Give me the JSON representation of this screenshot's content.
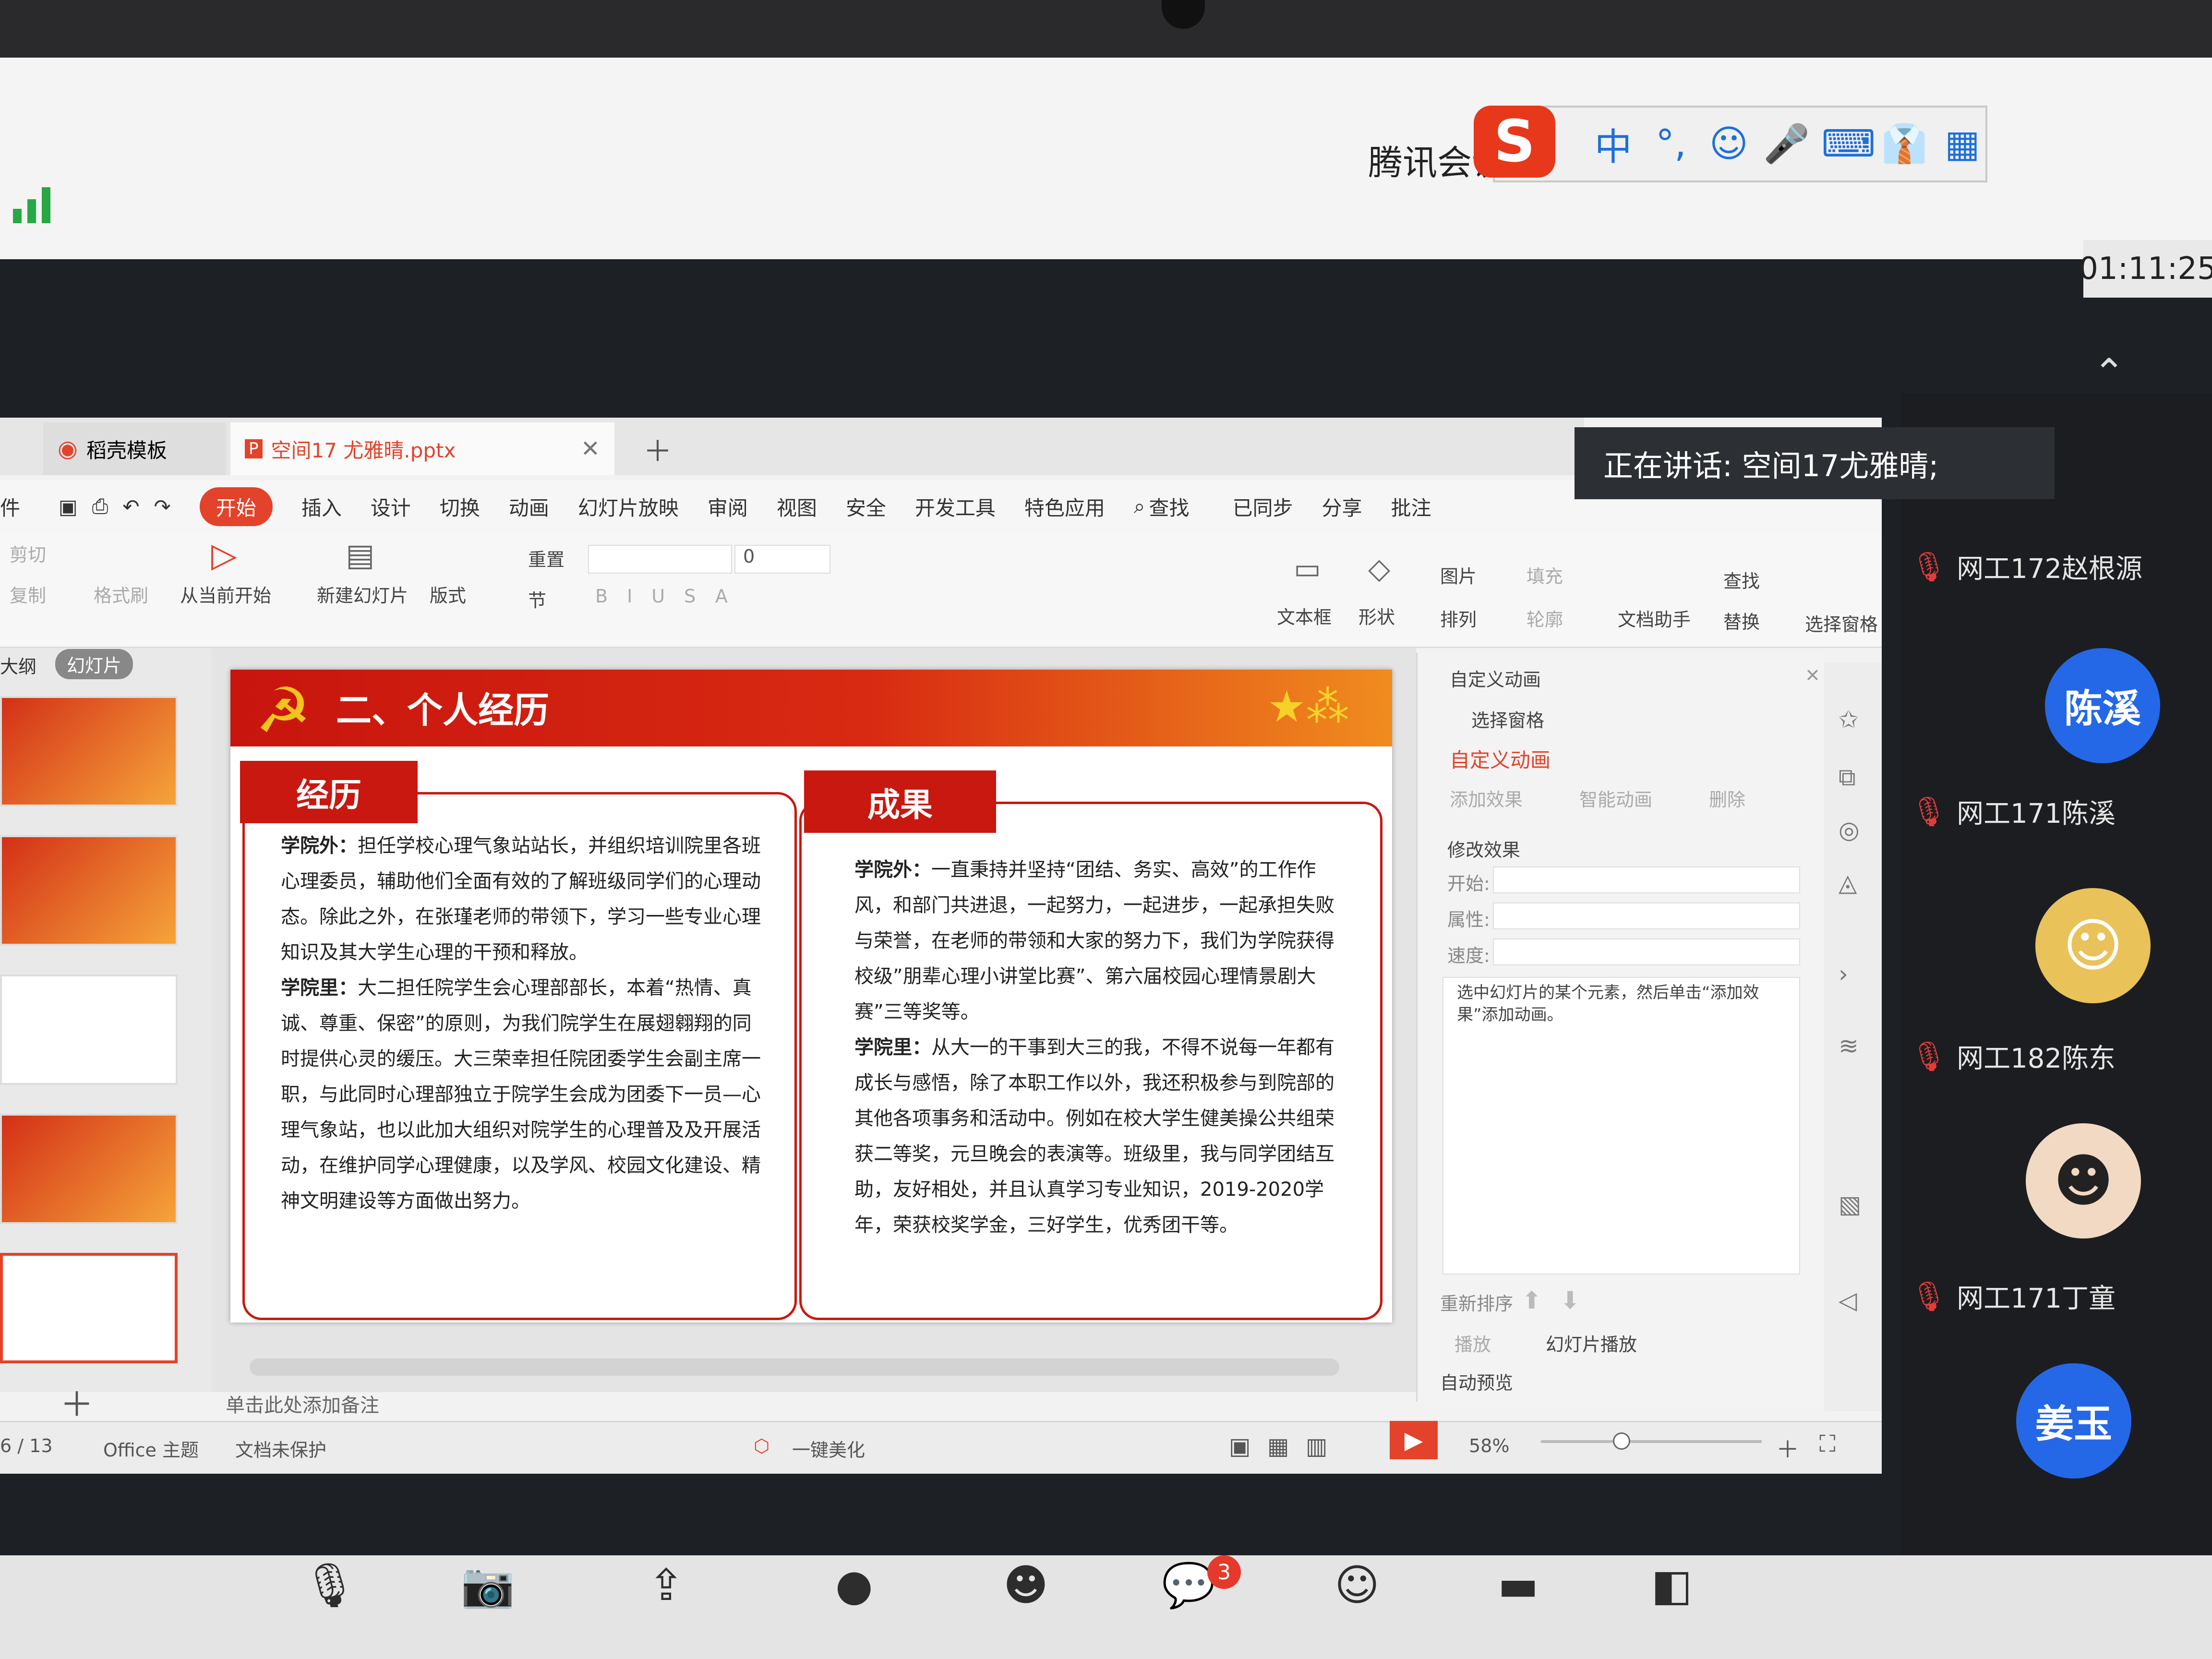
{
  "meeting": {
    "title": "腾讯会议",
    "timer": "01:11:25",
    "speaking": "正在讲话: 空间17尤雅晴;"
  },
  "ime": {
    "logo": "S",
    "items": [
      "中",
      "°,",
      "☺",
      "🎤",
      "⌨",
      "👔",
      "▦"
    ]
  },
  "participants": [
    {
      "name": "网工172赵根源",
      "muted": true
    },
    {
      "avatar_text": "陈溪",
      "avatar_color": "#2468e8"
    },
    {
      "name": "网工171陈溪",
      "muted": true
    },
    {
      "name": "网工182陈东",
      "muted": true
    },
    {
      "name": "网工171丁童",
      "muted": true
    },
    {
      "avatar_text": "姜玉",
      "avatar_color": "#2468e8"
    }
  ],
  "wps": {
    "tabs": [
      {
        "label": "稻壳模板"
      },
      {
        "label": "空间17 尤雅晴.pptx"
      }
    ],
    "menu": {
      "file": "件",
      "start": "开始",
      "items": [
        "插入",
        "设计",
        "切换",
        "动画",
        "幻灯片放映",
        "审阅",
        "视图",
        "安全",
        "开发工具",
        "特色应用"
      ],
      "search": "查找",
      "sync": "已同步",
      "share": "分享",
      "comment": "批注"
    },
    "ribbon": {
      "cut": "剪切",
      "copy": "复制",
      "format_painter": "格式刷",
      "from_current": "从当前开始",
      "new_slide": "新建幻灯片",
      "layout": "版式",
      "reset": "重置",
      "section": "节",
      "font_size": "0",
      "textbox": "文本框",
      "shape": "形状",
      "picture": "图片",
      "fill": "填充",
      "arrange": "排列",
      "outline": "轮廓",
      "doc_assistant": "文档助手",
      "find": "查找",
      "replace": "替换",
      "select_pane": "选择窗格"
    },
    "panel_tabs": {
      "outline": "大纲",
      "slides": "幻灯片"
    },
    "slide": {
      "title": "二、个人经历",
      "left_label": "经历",
      "right_label": "成果",
      "left_p1_head": "学院外：",
      "left_p1": "担任学校心理气象站站长，并组织培训院里各班心理委员，辅助他们全面有效的了解班级同学们的心理动态。除此之外，在张瑾老师的带领下，学习一些专业心理知识及其大学生心理的干预和释放。",
      "left_p2_head": "学院里：",
      "left_p2": "大二担任院学生会心理部部长，本着“热情、真诚、尊重、保密”的原则，为我们院学生在展翅翱翔的同时提供心灵的缓压。大三荣幸担任院团委学生会副主席一职，与此同时心理部独立于院学生会成为团委下一员—心理气象站，也以此加大组织对院学生的心理普及及开展活动，在维护同学心理健康，以及学风、校园文化建设、精神文明建设等方面做出努力。",
      "right_p1_head": "学院外：",
      "right_p1": "一直秉持并坚持“团结、务实、高效”的工作作风，和部门共进退，一起努力，一起进步，一起承担失败与荣誉，在老师的带领和大家的努力下，我们为学院获得校级”朋辈心理小讲堂比赛”、第六届校园心理情景剧大赛”三等奖等。",
      "right_p2_head": "学院里：",
      "right_p2": "从大一的干事到大三的我，不得不说每一年都有成长与感悟，除了本职工作以外，我还积极参与到院部的其他各项事务和活动中。例如在校大学生健美操公共组荣获二等奖，元旦晚会的表演等。班级里，我与同学团结互助，友好相处，并且认真学习专业知识，2019-2020学年，荣获校奖学金，三好学生，优秀团干等。"
    },
    "notes_placeholder": "单击此处添加备注",
    "anim_pane": {
      "header": "自定义动画",
      "select_pane": "选择窗格",
      "title": "自定义动画",
      "add_effect": "添加效果",
      "smart_anim": "智能动画",
      "delete": "删除",
      "modify": "修改效果",
      "start_label": "开始:",
      "property_label": "属性:",
      "speed_label": "速度:",
      "hint": "选中幻灯片的某个元素，然后单击“添加效果”添加动画。",
      "reorder": "重新排序",
      "play": "播放",
      "slideshow": "幻灯片播放",
      "autopreview": "自动预览"
    },
    "status": {
      "page": "6 / 13",
      "theme": "Office 主题",
      "protect": "文档未保护",
      "beautify": "一键美化",
      "zoom": "58%"
    }
  },
  "bottom": {
    "chat_badge": "3"
  }
}
